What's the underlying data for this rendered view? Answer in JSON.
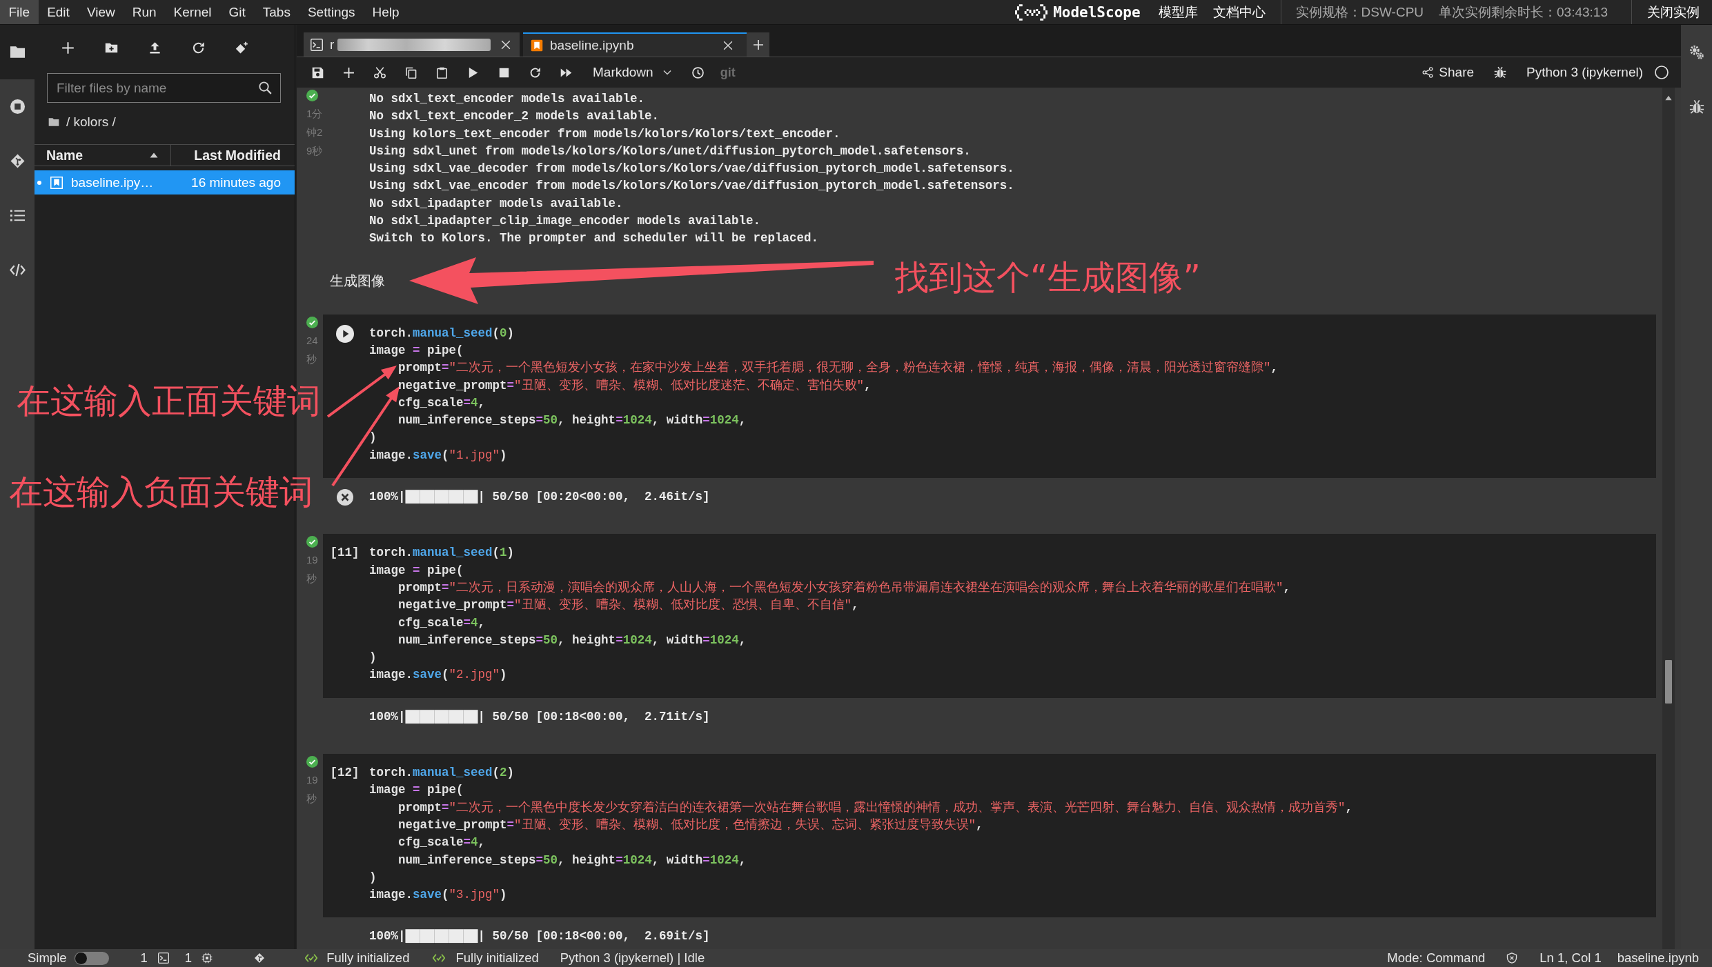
{
  "menu_bar": {
    "items": [
      {
        "label": "File",
        "selected": true
      },
      {
        "label": "Edit",
        "selected": false
      },
      {
        "label": "View",
        "selected": false
      },
      {
        "label": "Run",
        "selected": false
      },
      {
        "label": "Kernel",
        "selected": false
      },
      {
        "label": "Git",
        "selected": false
      },
      {
        "label": "Tabs",
        "selected": false
      },
      {
        "label": "Settings",
        "selected": false
      },
      {
        "label": "Help",
        "selected": false
      }
    ]
  },
  "header": {
    "logo_text": "ModelScope",
    "links": [
      "模型库",
      "文档中心"
    ],
    "instance_spec": "实例规格：DSW-CPU",
    "time_left": "单次实例剩余时长：03:43:13",
    "close_button": "关闭实例"
  },
  "left_sidebar": {
    "tabs": [
      {
        "kind": "folder",
        "selected": true
      },
      {
        "kind": "stop",
        "selected": false
      },
      {
        "kind": "git",
        "selected": false
      },
      {
        "kind": "list",
        "selected": false
      },
      {
        "kind": "code",
        "selected": false
      }
    ]
  },
  "file_browser": {
    "filter": {
      "placeholder": "Filter files by name"
    },
    "breadcrumb": "/ kolors /",
    "columns": [
      {
        "label": "Name",
        "sorted": true
      },
      {
        "label": "Last Modified",
        "sorted": false
      }
    ],
    "files": [
      {
        "name": "baseline.ipy…",
        "modified": "16 minutes ago",
        "selected": true,
        "running": true
      }
    ]
  },
  "tabs": [
    {
      "kind": "terminal",
      "label": "r",
      "redacted": true,
      "selected": false
    },
    {
      "kind": "notebook",
      "label": "baseline.ipynb",
      "redacted": false,
      "selected": true
    }
  ],
  "toolbar": {
    "cell_type": "Markdown",
    "git_label": "git",
    "share_label": "Share",
    "kernel_name": "Python 3 (ipykernel)",
    "kernel_busy": false
  },
  "cells": [
    {
      "kind": "code",
      "executed": true,
      "elapsed": "1分钟29秒",
      "hovered": false,
      "outputs": [
        "No sdxl_text_encoder models available.",
        "No sdxl_text_encoder_2 models available.",
        "Using kolors_text_encoder from models/kolors/Kolors/text_encoder.",
        "Using sdxl_unet from models/kolors/Kolors/unet/diffusion_pytorch_model.safetensors.",
        "Using sdxl_vae_decoder from models/kolors/Kolors/vae/diffusion_pytorch_model.safetensors.",
        "Using sdxl_vae_encoder from models/kolors/Kolors/vae/diffusion_pytorch_model.safetensors.",
        "No sdxl_ipadapter models available.",
        "No sdxl_ipadapter_clip_image_encoder models available.",
        "Switch to Kolors. The prompter and scheduler will be replaced."
      ]
    },
    {
      "kind": "markdown",
      "text": "生成图像"
    },
    {
      "kind": "code",
      "executed": true,
      "elapsed": "24秒",
      "hovered": true,
      "source": [
        "torch.manual_seed(0)",
        "image = pipe(",
        "    prompt=\"二次元，一个黑色短发小女孩，在家中沙发上坐着，双手托着腮，很无聊，全身，粉色连衣裙，憧憬，纯真，海报，偶像，清晨，阳光透过窗帘缝隙\",",
        "    negative_prompt=\"丑陋、变形、嘈杂、模糊、低对比度迷茫、不确定、害怕失败\",",
        "    cfg_scale=4,",
        "    num_inference_steps=50, height=1024, width=1024,",
        ")",
        "image.save(\"1.jpg\")"
      ],
      "outputs": [
        "100%|██████████| 50/50 [00:20<00:00,  2.46it/s]"
      ]
    },
    {
      "kind": "code",
      "executed": true,
      "elapsed": "19秒",
      "hovered": false,
      "prompt": "[11]",
      "source": [
        "torch.manual_seed(1)",
        "image = pipe(",
        "    prompt=\"二次元，日系动漫，演唱会的观众席，人山人海，一个黑色短发小女孩穿着粉色吊带漏肩连衣裙坐在演唱会的观众席，舞台上衣着华丽的歌星们在唱歌\",",
        "    negative_prompt=\"丑陋、变形、嘈杂、模糊、低对比度、恐惧、自卑、不自信\",",
        "    cfg_scale=4,",
        "    num_inference_steps=50, height=1024, width=1024,",
        ")",
        "image.save(\"2.jpg\")"
      ],
      "outputs": [
        "100%|██████████| 50/50 [00:18<00:00,  2.71it/s]"
      ]
    },
    {
      "kind": "code",
      "executed": true,
      "elapsed": "19秒",
      "hovered": false,
      "prompt": "[12]",
      "source": [
        "torch.manual_seed(2)",
        "image = pipe(",
        "    prompt=\"二次元，一个黑色中度长发少女穿着洁白的连衣裙第一次站在舞台歌唱，露出憧憬的神情，成功、掌声、表演、光芒四射、舞台魅力、自信、观众热情，成功首秀\",",
        "    negative_prompt=\"丑陋、变形、嘈杂、模糊、低对比度，色情擦边，失误、忘词、紧张过度导致失误\",",
        "    cfg_scale=4,",
        "    num_inference_steps=50, height=1024, width=1024,",
        ")",
        "image.save(\"3.jpg\")"
      ],
      "outputs": [
        "100%|██████████| 50/50 [00:18<00:00,  2.69it/s]"
      ]
    }
  ],
  "annotations": [
    {
      "text": "找到这个“生成图像”"
    },
    {
      "text": "在这输入正面关键词"
    },
    {
      "text": "在这输入负面关键词"
    }
  ],
  "status_bar": {
    "mode_label": "Simple",
    "simple_mode": false,
    "terminal_count": "1",
    "kernel_count": "1",
    "extension_statuses": [
      "Fully initialized",
      "Fully initialized"
    ],
    "kernel_status": "Python 3 (ipykernel) | Idle",
    "mode": "Mode: Command",
    "cursor": "Ln 1, Col 1",
    "file_name": "baseline.ipynb"
  }
}
